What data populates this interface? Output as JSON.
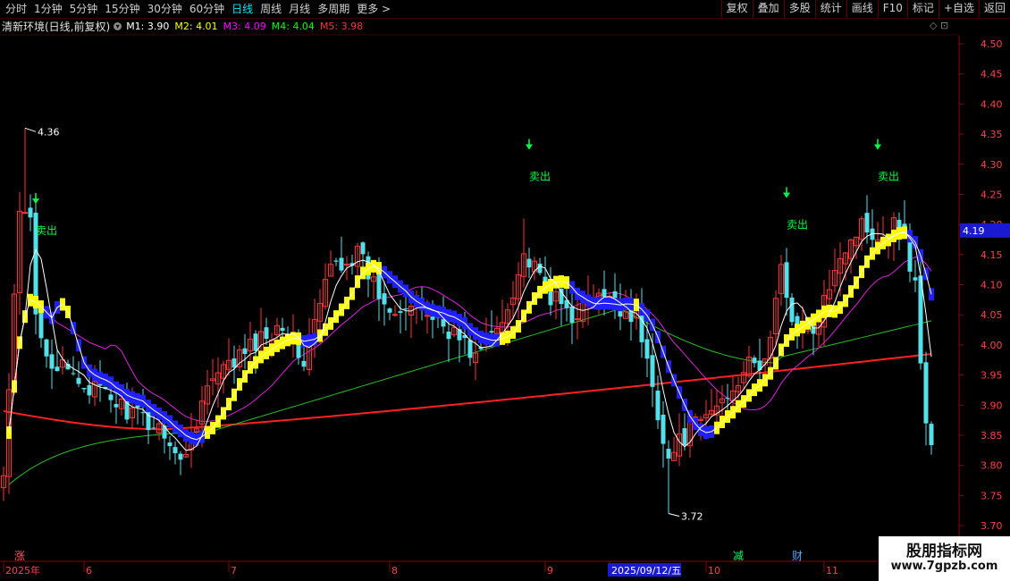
{
  "toolbar": {
    "periods": [
      "分时",
      "1分钟",
      "5分钟",
      "15分钟",
      "30分钟",
      "60分钟",
      "日线",
      "周线",
      "月线",
      "多周期",
      "更多 >"
    ],
    "active_period": "日线",
    "right_buttons": [
      "复权",
      "叠加",
      "多股",
      "统计",
      "画线",
      "F10",
      "标记",
      "+自选",
      "返回"
    ]
  },
  "info": {
    "stock": "清新环境(日线,前复权)",
    "ma": [
      {
        "label": "M1: 3.90",
        "color": "#ffffff"
      },
      {
        "label": "M2: 4.01",
        "color": "#ffff00"
      },
      {
        "label": "M3: 4.09",
        "color": "#ff00ff"
      },
      {
        "label": "M4: 4.04",
        "color": "#00ff00"
      },
      {
        "label": "M5: 3.98",
        "color": "#ff3333"
      }
    ],
    "icons": "◇ ⊡"
  },
  "watermark": {
    "line1": "股朋指标网",
    "line2": "www.7gpzb.com"
  },
  "chart_data": {
    "type": "candlestick",
    "ylim": [
      3.67,
      4.55
    ],
    "yticks": [
      "4.50",
      "4.45",
      "4.40",
      "4.35",
      "4.30",
      "4.25",
      "4.20",
      "4.15",
      "4.10",
      "4.05",
      "4.00",
      "3.95",
      "3.90",
      "3.85",
      "3.80",
      "3.75",
      "3.70"
    ],
    "current_price": "4.19",
    "high_label": "4.36",
    "low_label": "3.72",
    "date_labels": [
      {
        "text": "2025年",
        "index": 0
      },
      {
        "text": "6",
        "index": 15
      },
      {
        "text": "7",
        "index": 42
      },
      {
        "text": "8",
        "index": 72
      },
      {
        "text": "9",
        "index": 101
      },
      {
        "text": "2025/09/12/五",
        "index": 113,
        "highlight": true
      },
      {
        "text": "10",
        "index": 131
      },
      {
        "text": "11",
        "index": 153
      }
    ],
    "markers": [
      {
        "text": "涨",
        "index": 2,
        "color": "#ff5555"
      },
      {
        "text": "减",
        "index": 136,
        "color": "#00ff66"
      },
      {
        "text": "财",
        "index": 147,
        "color": "#4da6ff"
      }
    ],
    "sell_signals": [
      {
        "index": 6,
        "price": 4.24,
        "label": "卖出"
      },
      {
        "index": 98,
        "price": 4.33,
        "label": "卖出"
      },
      {
        "index": 146,
        "price": 4.25,
        "label": "卖出"
      },
      {
        "index": 163,
        "price": 4.33,
        "label": "卖出"
      }
    ],
    "keypoints": [
      [
        0,
        3.78
      ],
      [
        4,
        4.36
      ],
      [
        6,
        4.05
      ],
      [
        9,
        3.97
      ],
      [
        14,
        3.94
      ],
      [
        20,
        3.91
      ],
      [
        25,
        3.88
      ],
      [
        30,
        3.86
      ],
      [
        33,
        3.8
      ],
      [
        38,
        3.93
      ],
      [
        44,
        3.98
      ],
      [
        52,
        4.04
      ],
      [
        56,
        3.97
      ],
      [
        61,
        4.13
      ],
      [
        66,
        4.15
      ],
      [
        71,
        4.07
      ],
      [
        78,
        4.06
      ],
      [
        84,
        4.02
      ],
      [
        88,
        3.98
      ],
      [
        93,
        4.04
      ],
      [
        97,
        4.15
      ],
      [
        102,
        4.08
      ],
      [
        106,
        4.05
      ],
      [
        110,
        4.08
      ],
      [
        115,
        4.06
      ],
      [
        118,
        4.05
      ],
      [
        121,
        3.93
      ],
      [
        124,
        3.81
      ],
      [
        127,
        3.85
      ],
      [
        131,
        3.88
      ],
      [
        135,
        3.92
      ],
      [
        138,
        3.96
      ],
      [
        142,
        3.97
      ],
      [
        145,
        4.12
      ],
      [
        148,
        4.02
      ],
      [
        152,
        4.03
      ],
      [
        155,
        4.14
      ],
      [
        160,
        4.2
      ],
      [
        164,
        4.18
      ],
      [
        167,
        4.21
      ],
      [
        170,
        4.1
      ],
      [
        172,
        3.86
      ],
      [
        173,
        3.84
      ]
    ]
  }
}
